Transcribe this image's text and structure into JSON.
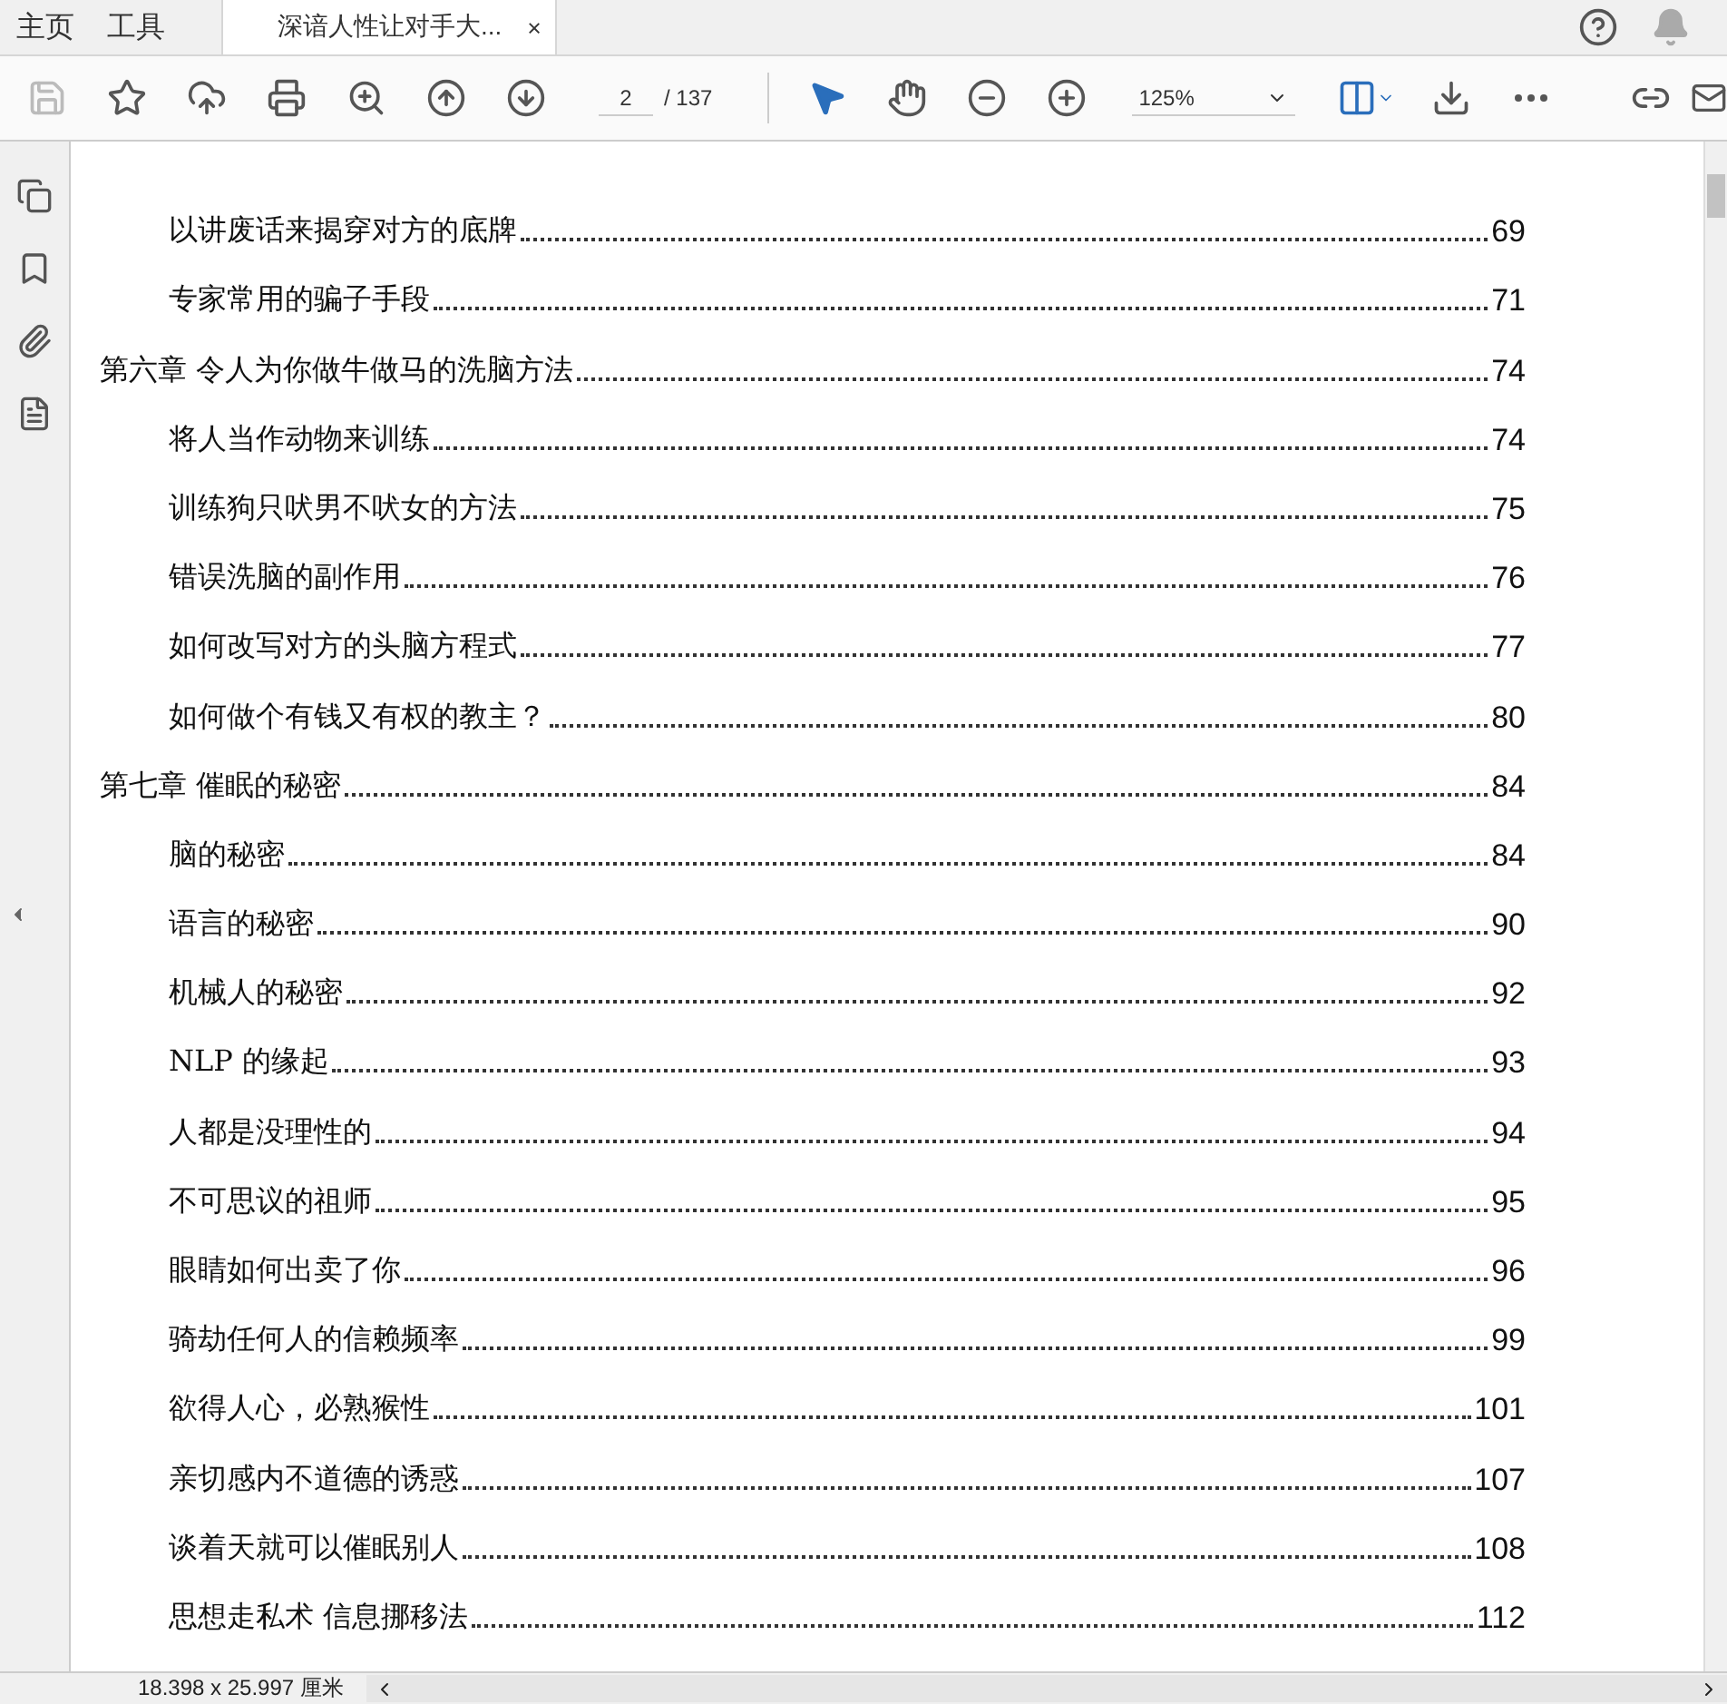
{
  "tabs": [
    {
      "label": "主页",
      "kind": "nav",
      "selected": false
    },
    {
      "label": "工具",
      "kind": "nav",
      "selected": false
    },
    {
      "label": "深谙人性让对手大...",
      "kind": "document",
      "selected": true,
      "close": "×"
    }
  ],
  "toolbar": {
    "page_number": "2",
    "page_total": "/ 137",
    "zoom": "125%"
  },
  "toc": {
    "sections_before": [
      {
        "title": "以讲废话来揭穿对方的底牌",
        "page": "69"
      },
      {
        "title": "专家常用的骗子手段",
        "page": "71"
      }
    ],
    "chapters": [
      {
        "title": "第六章 令人为你做牛做马的洗脑方法",
        "page": "74",
        "children": [
          {
            "title": "将人当作动物来训练",
            "page": "74"
          },
          {
            "title": "训练狗只吠男不吠女的方法",
            "page": "75"
          },
          {
            "title": "错误洗脑的副作用",
            "page": "76"
          },
          {
            "title": "如何改写对方的头脑方程式",
            "page": "77"
          },
          {
            "title": "如何做个有钱又有权的教主？",
            "page": "80"
          }
        ]
      },
      {
        "title": "第七章 催眠的秘密",
        "page": "84",
        "children": [
          {
            "title": "脑的秘密",
            "page": "84"
          },
          {
            "title": "语言的秘密",
            "page": "90"
          },
          {
            "title": "机械人的秘密",
            "page": "92"
          },
          {
            "title": "NLP 的缘起",
            "page": "93"
          },
          {
            "title": "人都是没理性的",
            "page": "94"
          },
          {
            "title": "不可思议的祖师",
            "page": "95"
          },
          {
            "title": "眼睛如何出卖了你",
            "page": "96"
          },
          {
            "title": "骑劫任何人的信赖频率",
            "page": "99"
          },
          {
            "title": "欲得人心，必熟猴性",
            "page": "101"
          },
          {
            "title": "亲切感内不道德的诱惑",
            "page": "107"
          },
          {
            "title": "谈着天就可以催眠别人",
            "page": "108"
          },
          {
            "title": "思想走私术 信息挪移法",
            "page": "112"
          }
        ]
      }
    ]
  },
  "status_bar": {
    "page_size": "18.398 x 25.997 厘米"
  }
}
